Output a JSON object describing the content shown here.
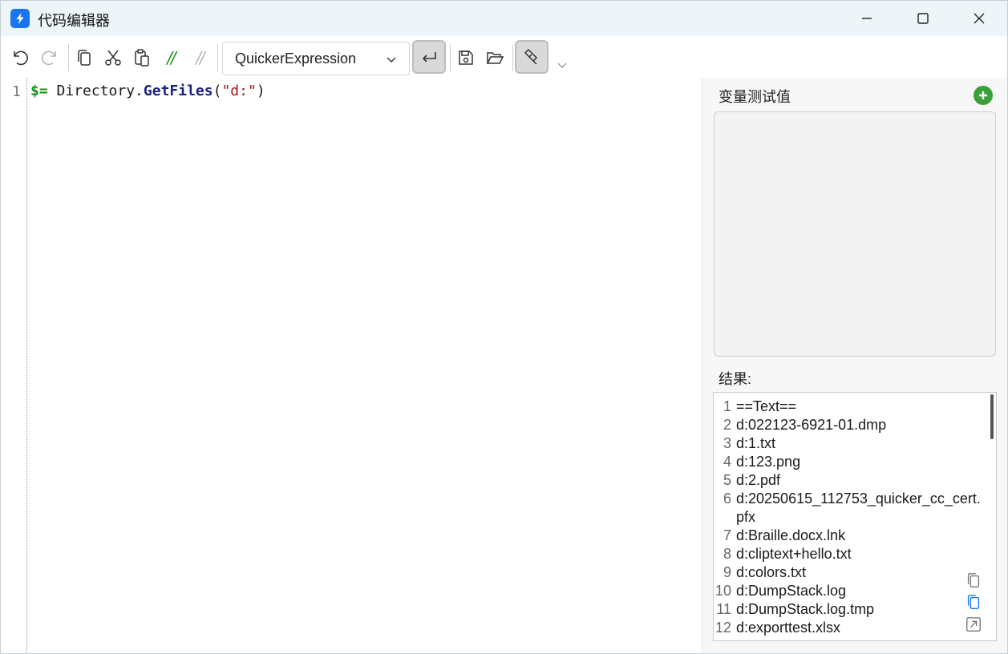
{
  "window": {
    "title": "代码编辑器"
  },
  "toolbar": {
    "language_selected": "QuickerExpression",
    "comment_glyph": "//",
    "uncomment_glyph": "//"
  },
  "editor": {
    "line_number": "1",
    "tokens": {
      "dollar": "$=",
      "object": " Directory.",
      "method": "GetFiles",
      "open_paren": "(",
      "string": "\"d:\"",
      "close_paren": ")"
    }
  },
  "right_panel": {
    "variables_label": "变量测试值",
    "result_label": "结果:",
    "results": [
      {
        "n": "1",
        "text": "==Text=="
      },
      {
        "n": "2",
        "text": "d:022123-6921-01.dmp"
      },
      {
        "n": "3",
        "text": "d:1.txt"
      },
      {
        "n": "4",
        "text": "d:123.png"
      },
      {
        "n": "5",
        "text": "d:2.pdf"
      },
      {
        "n": "6",
        "text": "d:20250615_112753_quicker_cc_cert.pfx"
      },
      {
        "n": "7",
        "text": "d:Braille.docx.lnk"
      },
      {
        "n": "8",
        "text": "d:cliptext+hello.txt"
      },
      {
        "n": "9",
        "text": "d:colors.txt"
      },
      {
        "n": "10",
        "text": "d:DumpStack.log"
      },
      {
        "n": "11",
        "text": "d:DumpStack.log.tmp"
      },
      {
        "n": "12",
        "text": "d:exporttest.xlsx"
      }
    ]
  },
  "colors": {
    "accent_blue": "#1976f0",
    "add_green": "#3aa13a",
    "keyword_green": "#1a8f1a",
    "method_navy": "#1a237e",
    "string_red": "#a31515"
  },
  "icons": [
    "lightning-icon",
    "minimize-icon",
    "maximize-icon",
    "close-icon",
    "undo-icon",
    "redo-icon",
    "copy-icon",
    "cut-icon",
    "paste-icon",
    "comment-icon",
    "uncomment-icon",
    "chevron-down-icon",
    "word-wrap-icon",
    "save-icon",
    "open-folder-icon",
    "pin-icon",
    "add-icon",
    "copy-result-icon",
    "copy-result-blue-icon",
    "open-external-icon"
  ]
}
